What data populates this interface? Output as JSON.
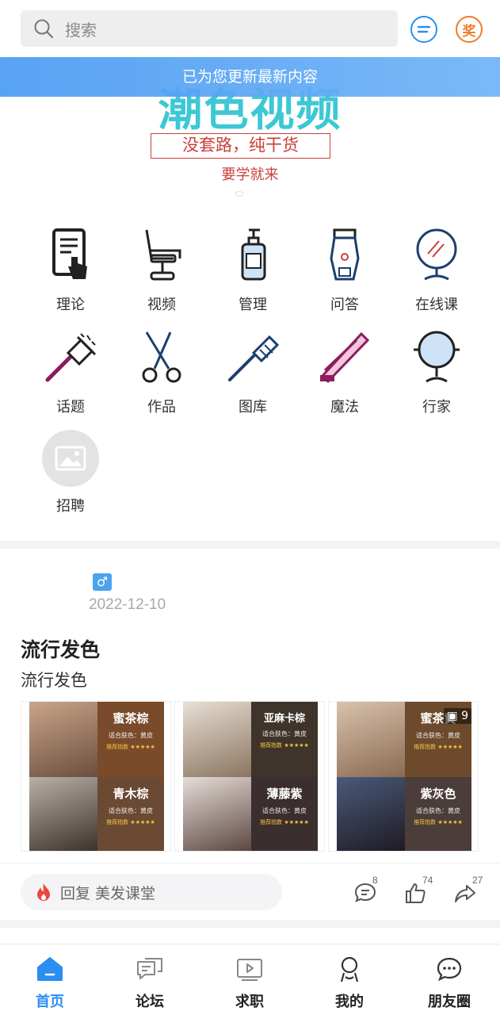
{
  "search": {
    "placeholder": "搜索"
  },
  "header_icons": {
    "message": "chat-bubble-icon",
    "award": "奖"
  },
  "banner": {
    "title": "潮色视频",
    "slogan": "没套路，纯干货",
    "sub": "要学就来",
    "notice": "已为您更新最新内容"
  },
  "menu": [
    {
      "label": "理论",
      "icon": "tablet-hand-icon"
    },
    {
      "label": "视频",
      "icon": "barber-chair-icon"
    },
    {
      "label": "管理",
      "icon": "pump-bottle-icon"
    },
    {
      "label": "问答",
      "icon": "hair-clipper-icon"
    },
    {
      "label": "在线课",
      "icon": "mirror-icon"
    },
    {
      "label": "话题",
      "icon": "dye-brush-icon"
    },
    {
      "label": "作品",
      "icon": "scissors-icon"
    },
    {
      "label": "图库",
      "icon": "comb-icon"
    },
    {
      "label": "魔法",
      "icon": "flat-iron-icon"
    },
    {
      "label": "行家",
      "icon": "round-mirror-icon"
    },
    {
      "label": "招聘",
      "icon": "image-placeholder-icon"
    }
  ],
  "post": {
    "gender": "♂",
    "date": "2022-12-10",
    "title": "流行发色",
    "desc": "流行发色",
    "image_count": "9",
    "thumbs": [
      {
        "top": {
          "name": "蜜茶棕",
          "color": "#7a4b2a"
        },
        "bottom": {
          "name": "青木棕",
          "color": "#6b4a33"
        }
      },
      {
        "top": {
          "name": "亚麻卡棕",
          "color": "#3e342b"
        },
        "bottom": {
          "name": "薄藤紫",
          "color": "#3a2e2e"
        }
      },
      {
        "top": {
          "name": "蜜茶黄",
          "color": "#6e4a2c"
        },
        "bottom": {
          "name": "紫灰色",
          "color": "#4a3d3a"
        }
      }
    ],
    "card_line": "适合肤色：黄皮",
    "stars": "推荐指数 ★★★★★"
  },
  "actions": {
    "reply": "回复 美发课堂",
    "comments": "8",
    "likes": "74",
    "shares": "27"
  },
  "nav": [
    {
      "label": "首页",
      "icon": "home-icon",
      "active": true
    },
    {
      "label": "论坛",
      "icon": "forum-icon",
      "active": false
    },
    {
      "label": "求职",
      "icon": "video-icon",
      "active": false
    },
    {
      "label": "我的",
      "icon": "user-icon",
      "active": false
    },
    {
      "label": "朋友圈",
      "icon": "friends-chat-icon",
      "active": false
    }
  ],
  "colors": {
    "accent": "#2b8ef0",
    "award": "#f07a2a",
    "banner_title": "#3cc8d4"
  }
}
